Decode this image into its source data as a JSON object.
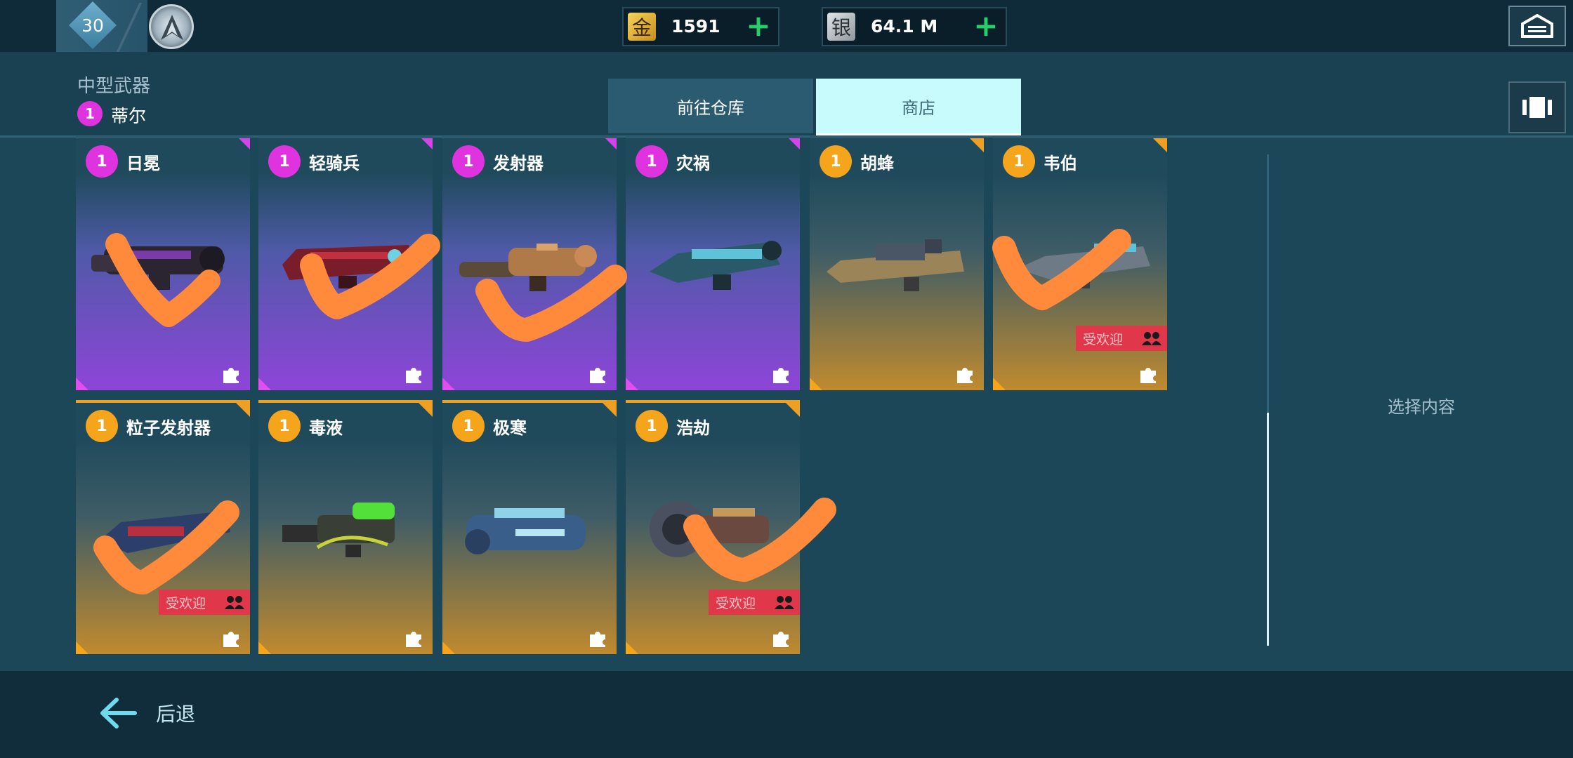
{
  "topbar": {
    "level": "30",
    "gold": {
      "icon_label": "金",
      "value": "1591"
    },
    "silver": {
      "icon_label": "银",
      "value": "64.1 M"
    }
  },
  "header": {
    "category": "中型武器",
    "pilot_badge": "1",
    "pilot_name": "蒂尔"
  },
  "tabs": {
    "storage": "前往仓库",
    "shop": "商店"
  },
  "cards": [
    {
      "name": "日冕",
      "level": "1",
      "rarity": "epic",
      "checked": true,
      "popular": false
    },
    {
      "name": "轻骑兵",
      "level": "1",
      "rarity": "epic",
      "checked": true,
      "popular": false
    },
    {
      "name": "发射器",
      "level": "1",
      "rarity": "epic",
      "checked": true,
      "popular": false
    },
    {
      "name": "灾祸",
      "level": "1",
      "rarity": "epic",
      "checked": false,
      "popular": false
    },
    {
      "name": "胡蜂",
      "level": "1",
      "rarity": "legendary",
      "checked": false,
      "popular": false
    },
    {
      "name": "韦伯",
      "level": "1",
      "rarity": "legendary",
      "checked": true,
      "popular": true
    },
    {
      "name": "粒子发射器",
      "level": "1",
      "rarity": "legendary",
      "checked": true,
      "popular": true
    },
    {
      "name": "毒液",
      "level": "1",
      "rarity": "legendary",
      "checked": false,
      "popular": false
    },
    {
      "name": "极寒",
      "level": "1",
      "rarity": "legendary",
      "checked": false,
      "popular": false
    },
    {
      "name": "浩劫",
      "level": "1",
      "rarity": "legendary",
      "checked": true,
      "popular": true
    }
  ],
  "popular_label": "受欢迎",
  "right_panel": {
    "hint": "选择内容"
  },
  "bottom": {
    "back_label": "后退"
  },
  "colors": {
    "epic": "#e033e0",
    "legendary": "#f4a51c",
    "check_mark": "#ff8a3c",
    "popular": "#e0384a",
    "currency_plus": "#25d06a"
  },
  "icons": [
    "rank-emblem-icon",
    "gold-coin-icon",
    "silver-coin-icon",
    "plus-icon",
    "garage-icon",
    "collapse-panel-icon",
    "puzzle-piece-icon",
    "popular-people-icon",
    "back-arrow-icon"
  ]
}
